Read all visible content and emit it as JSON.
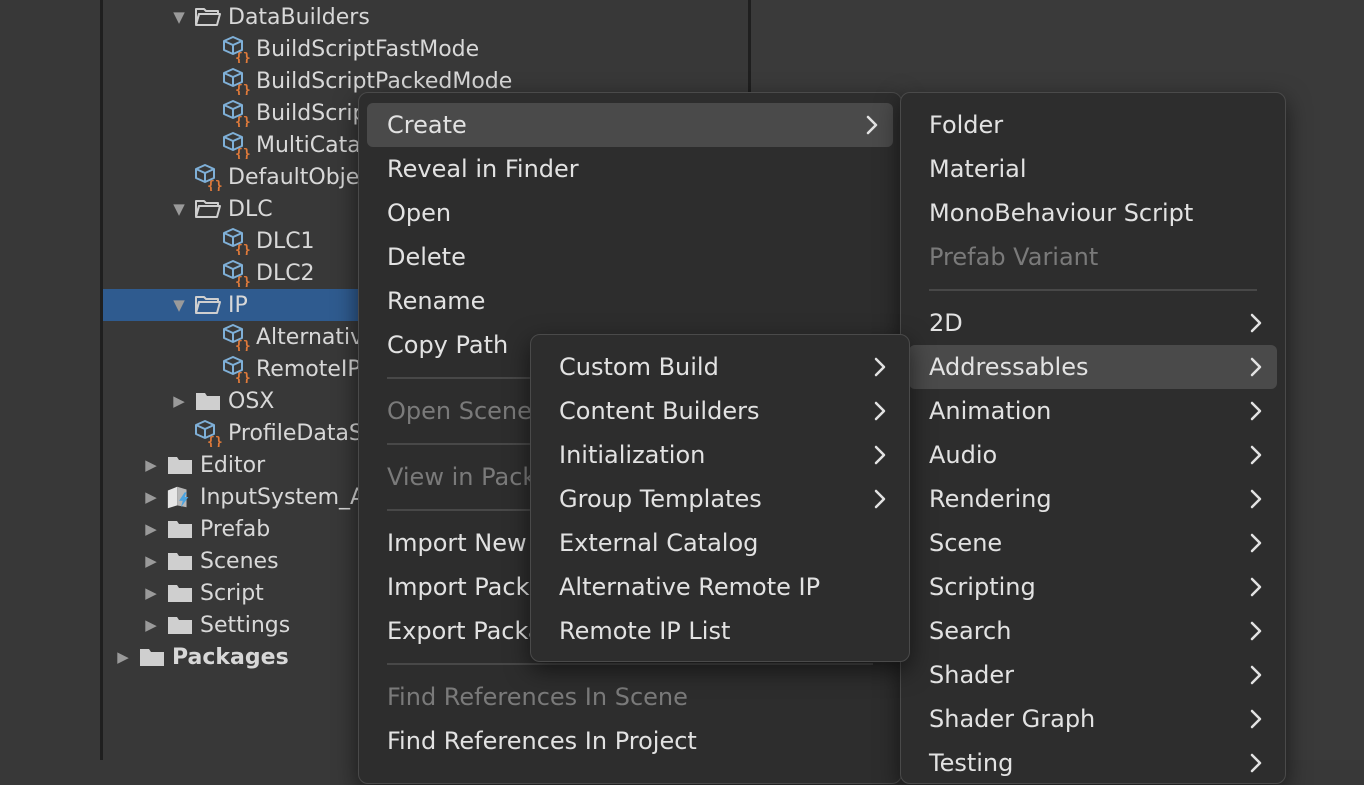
{
  "project_tree": {
    "items": [
      {
        "label": "DataBuilders",
        "type": "folder-open",
        "expanded": true
      },
      {
        "label": "BuildScriptFastMode",
        "type": "script-asset"
      },
      {
        "label": "BuildScriptPackedMode",
        "type": "script-asset"
      },
      {
        "label": "BuildScriptPackedPlayMode",
        "type": "script-asset"
      },
      {
        "label": "MultiCatalogBuildScript",
        "type": "script-asset"
      },
      {
        "label": "DefaultObject",
        "type": "script-asset"
      },
      {
        "label": "DLC",
        "type": "folder-open",
        "expanded": true
      },
      {
        "label": "DLC1",
        "type": "script-asset"
      },
      {
        "label": "DLC2",
        "type": "script-asset"
      },
      {
        "label": "IP",
        "type": "folder-open",
        "expanded": true,
        "selected": true
      },
      {
        "label": "AlternativeRemoteIP",
        "type": "script-asset"
      },
      {
        "label": "RemoteIPList",
        "type": "script-asset"
      },
      {
        "label": "OSX",
        "type": "folder",
        "expanded": false
      },
      {
        "label": "ProfileDataSourceSettings",
        "type": "script-asset"
      },
      {
        "label": "Editor",
        "type": "folder",
        "expanded": false
      },
      {
        "label": "InputSystem_Actions",
        "type": "input-actions",
        "expanded": false
      },
      {
        "label": "Prefab",
        "type": "folder",
        "expanded": false
      },
      {
        "label": "Scenes",
        "type": "folder",
        "expanded": false
      },
      {
        "label": "Script",
        "type": "folder",
        "expanded": false
      },
      {
        "label": "Settings",
        "type": "folder",
        "expanded": false
      },
      {
        "label": "Packages",
        "type": "folder",
        "expanded": false
      }
    ]
  },
  "context_menu": {
    "items": [
      {
        "label": "Create",
        "has_submenu": true,
        "highlighted": true
      },
      {
        "label": "Reveal in Finder"
      },
      {
        "label": "Open"
      },
      {
        "label": "Delete"
      },
      {
        "label": "Rename"
      },
      {
        "label": "Copy Path"
      },
      {
        "label": "Open Scene Additive",
        "disabled": true
      },
      {
        "label": "View in Package Manager",
        "disabled": true
      },
      {
        "label": "Import New Asset..."
      },
      {
        "label": "Import Package"
      },
      {
        "label": "Export Package..."
      },
      {
        "label": "Find References In Scene",
        "disabled": true
      },
      {
        "label": "Find References In Project"
      }
    ]
  },
  "create_submenu": {
    "items": [
      {
        "label": "Folder"
      },
      {
        "label": "Material"
      },
      {
        "label": "MonoBehaviour Script"
      },
      {
        "label": "Prefab Variant",
        "disabled": true
      },
      {
        "label": "2D",
        "has_submenu": true
      },
      {
        "label": "Addressables",
        "has_submenu": true,
        "highlighted": true
      },
      {
        "label": "Animation",
        "has_submenu": true
      },
      {
        "label": "Audio",
        "has_submenu": true
      },
      {
        "label": "Rendering",
        "has_submenu": true
      },
      {
        "label": "Scene",
        "has_submenu": true
      },
      {
        "label": "Scripting",
        "has_submenu": true
      },
      {
        "label": "Search",
        "has_submenu": true
      },
      {
        "label": "Shader",
        "has_submenu": true
      },
      {
        "label": "Shader Graph",
        "has_submenu": true
      },
      {
        "label": "Testing",
        "has_submenu": true
      }
    ]
  },
  "addressables_submenu": {
    "items": [
      {
        "label": "Custom Build",
        "has_submenu": true
      },
      {
        "label": "Content Builders",
        "has_submenu": true
      },
      {
        "label": "Initialization",
        "has_submenu": true
      },
      {
        "label": "Group Templates",
        "has_submenu": true
      },
      {
        "label": "External Catalog"
      },
      {
        "label": "Alternative Remote IP"
      },
      {
        "label": "Remote IP List"
      }
    ]
  },
  "colors": {
    "selection": "#2f5b8f",
    "menu_bg": "#2d2d2d",
    "menu_highlight": "#4a4a4a",
    "script_icon_cube": "#7fb0d8",
    "script_icon_braces": "#e07a3a"
  }
}
